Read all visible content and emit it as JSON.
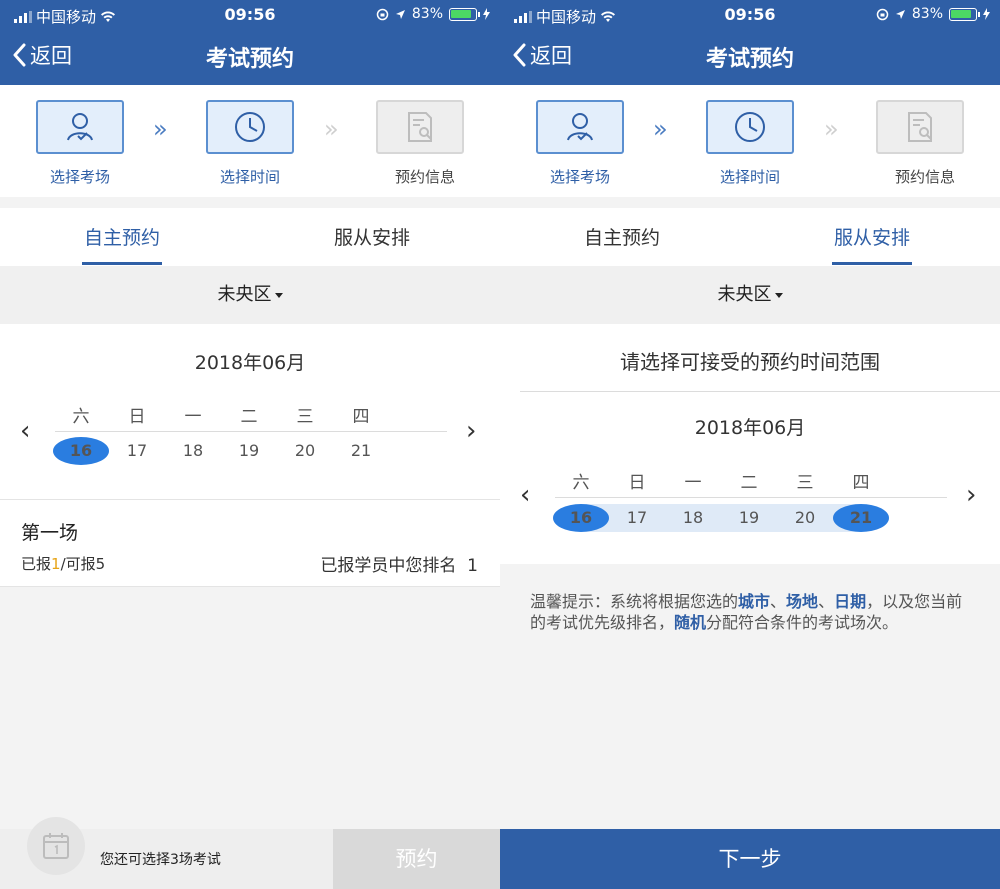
{
  "status": {
    "carrier": "中国移动",
    "time": "09:56",
    "battery": "83%"
  },
  "nav": {
    "back_label": "返回",
    "title": "考试预约"
  },
  "steps": [
    {
      "label": "选择考场",
      "icon": "user-check-icon"
    },
    {
      "label": "选择时间",
      "icon": "clock-icon"
    },
    {
      "label": "预约信息",
      "icon": "document-search-icon"
    }
  ],
  "tabs": {
    "self": "自主预约",
    "assigned": "服从安排"
  },
  "district": "未央区",
  "calendar": {
    "month": "2018年06月",
    "weekdays": [
      "六",
      "日",
      "一",
      "二",
      "三",
      "四"
    ],
    "dates": [
      "16",
      "17",
      "18",
      "19",
      "20",
      "21"
    ]
  },
  "session": {
    "name": "第一场",
    "reported_label": "已报",
    "reported_count": "1",
    "capacity_label": "/可报5",
    "rank_text": "已报学员中您排名",
    "rank": "1"
  },
  "bottom": {
    "message": "您还可选择3场考试",
    "reserve_button": "预约"
  },
  "right": {
    "range_prompt": "请选择可接受的预约时间范围",
    "hint_prefix": "温馨提示：系统将根据您选的",
    "hint_city": "城市",
    "hint_sep1": "、",
    "hint_site": "场地",
    "hint_sep2": "、",
    "hint_date": "日期",
    "hint_mid": "，以及您当前的考试优先级排名，",
    "hint_random": "随机",
    "hint_suffix": "分配符合条件的考试场次。",
    "next_button": "下一步"
  },
  "colors": {
    "brand": "#2f5fa6",
    "selected_date": "#2a7de0",
    "highlight": "#e7a416"
  }
}
